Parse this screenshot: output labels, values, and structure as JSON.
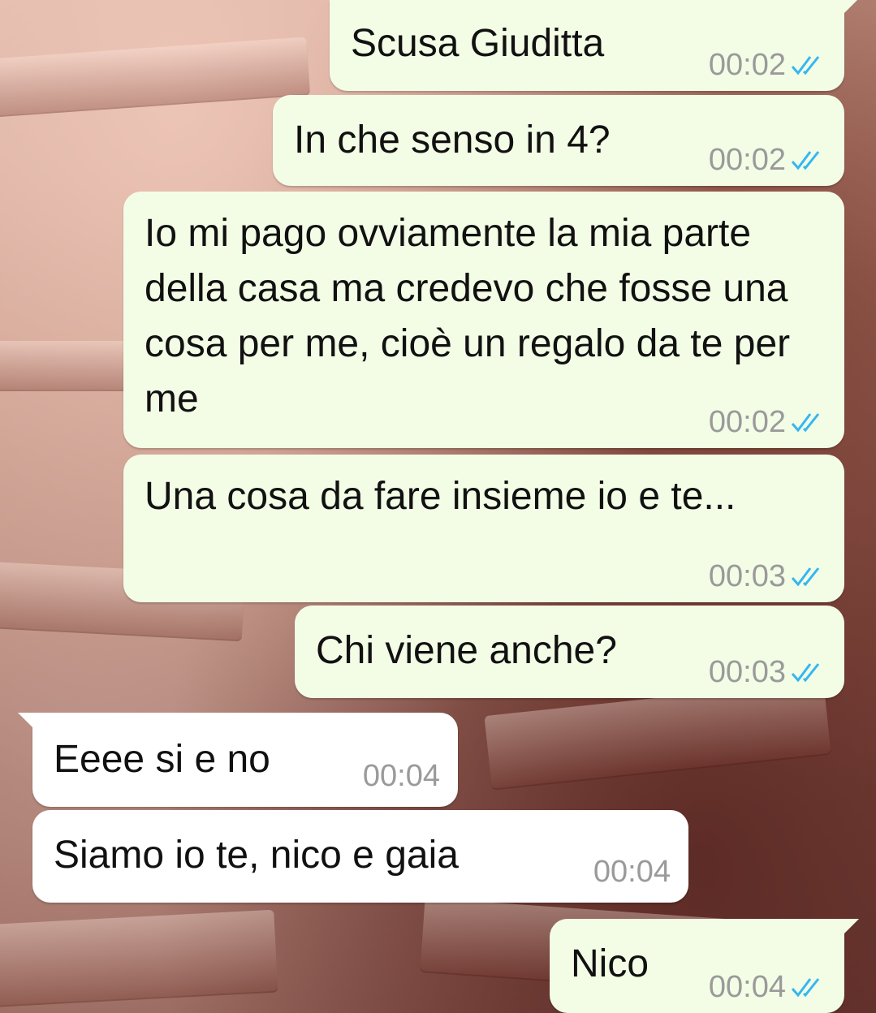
{
  "messages": [
    {
      "direction": "outgoing",
      "text": "Scusa Giuditta",
      "time": "00:02",
      "status": "read-double-check-icon"
    },
    {
      "direction": "outgoing",
      "text": "In che senso in 4?",
      "time": "00:02",
      "status": "read-double-check-icon"
    },
    {
      "direction": "outgoing",
      "text": "Io mi pago ovviamente la mia parte della casa ma credevo che fosse una cosa per me, cioè un regalo da te per me",
      "time": "00:02",
      "status": "read-double-check-icon"
    },
    {
      "direction": "outgoing",
      "text": "Una cosa da fare insieme io e te...",
      "time": "00:03",
      "status": "read-double-check-icon"
    },
    {
      "direction": "outgoing",
      "text": "Chi viene anche?",
      "time": "00:03",
      "status": "read-double-check-icon"
    },
    {
      "direction": "incoming",
      "text": "Eeee si e no",
      "time": "00:04"
    },
    {
      "direction": "incoming",
      "text": "Siamo io te, nico e gaia",
      "time": "00:04"
    },
    {
      "direction": "outgoing",
      "text": "Nico",
      "time": "00:04",
      "status": "read-double-check-icon"
    }
  ],
  "colors": {
    "outgoing_bubble": "#f3fde6",
    "incoming_bubble": "#ffffff",
    "read_ticks": "#34b7f1",
    "timestamp": "#9a9a9a"
  }
}
